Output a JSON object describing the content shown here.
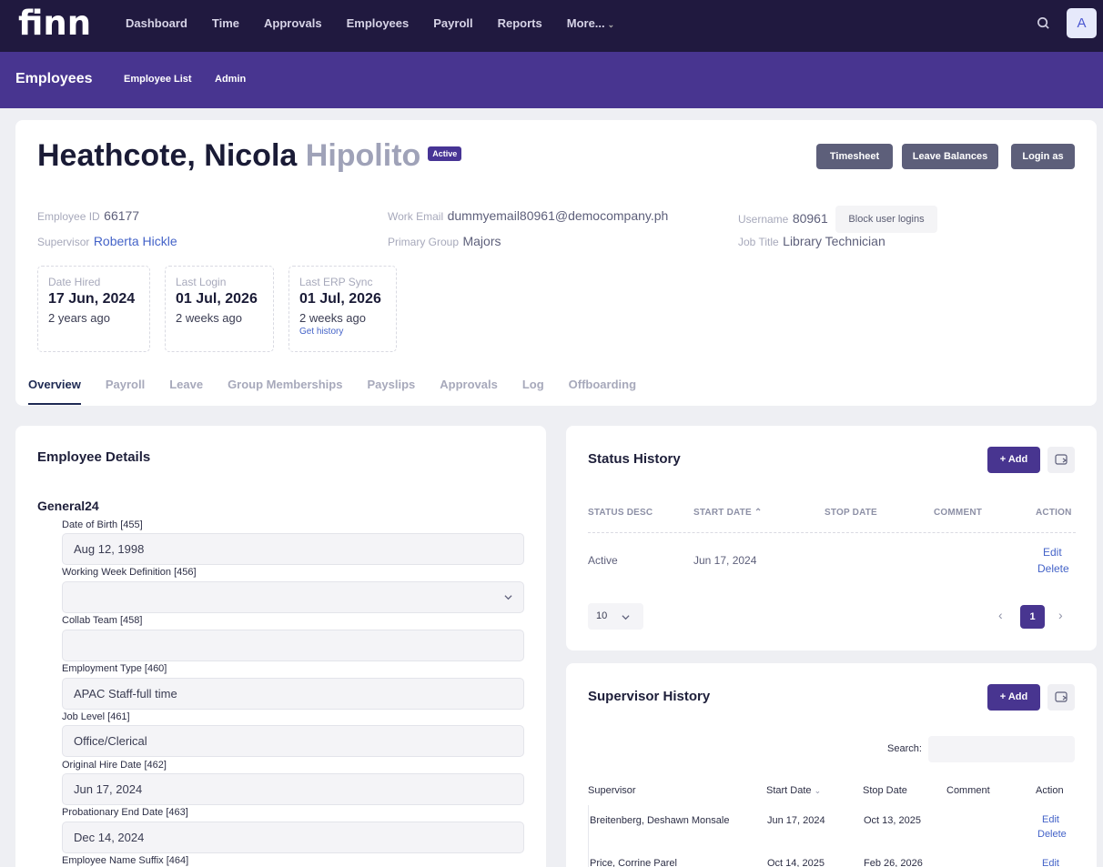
{
  "app": {
    "logo": "finn"
  },
  "nav": {
    "items": [
      "Dashboard",
      "Time",
      "Approvals",
      "Employees",
      "Payroll",
      "Reports",
      "More..."
    ],
    "avatar": "A"
  },
  "subnav": {
    "section": "Employees",
    "items": [
      "Employee List",
      "Admin"
    ]
  },
  "employee": {
    "last_first": "Heathcote, Nicola",
    "middle": "Hipolito",
    "status": "Active",
    "buttons": [
      "Timesheet",
      "Leave Balances",
      "Login as"
    ],
    "id_label": "Employee ID",
    "id": "66177",
    "supervisor_label": "Supervisor",
    "supervisor": "Roberta Hickle",
    "email_label": "Work Email",
    "email": "dummyemail80961@democompany.ph",
    "group_label": "Primary Group",
    "group": "Majors",
    "username_label": "Username",
    "username": "80961",
    "block_label": "Block user logins",
    "title_label": "Job Title",
    "title": "Library Technician"
  },
  "stats": [
    {
      "label": "Date Hired",
      "date": "17 Jun, 2024",
      "ago": "2 years ago"
    },
    {
      "label": "Last Login",
      "date": "01 Jul, 2026",
      "ago": "2 weeks ago"
    },
    {
      "label": "Last ERP Sync",
      "date": "01 Jul, 2026",
      "ago": "2 weeks ago",
      "link": "Get history"
    }
  ],
  "tabs": [
    "Overview",
    "Payroll",
    "Leave",
    "Group Memberships",
    "Payslips",
    "Approvals",
    "Log",
    "Offboarding"
  ],
  "details": {
    "title": "Employee Details",
    "group": "General24",
    "fields": [
      {
        "label": "Date of Birth [455]",
        "value": "Aug 12, 1998"
      },
      {
        "label": "Working Week Definition [456]",
        "value": ""
      },
      {
        "label": "Collab Team [458]",
        "value": ""
      },
      {
        "label": "Employment Type [460]",
        "value": "APAC Staff-full time"
      },
      {
        "label": "Job Level [461]",
        "value": "Office/Clerical"
      },
      {
        "label": "Original Hire Date [462]",
        "value": "Jun 17, 2024"
      },
      {
        "label": "Probationary End Date [463]",
        "value": "Dec 14, 2024"
      },
      {
        "label": "Employee Name Suffix [464]",
        "value": ""
      }
    ]
  },
  "status_history": {
    "title": "Status History",
    "add": "+ Add",
    "columns": [
      "STATUS DESC",
      "START DATE",
      "STOP DATE",
      "COMMENT",
      "ACTION"
    ],
    "rows": [
      {
        "status": "Active",
        "start": "Jun 17, 2024",
        "stop": "",
        "comment": "",
        "edit": "Edit",
        "delete": "Delete"
      }
    ],
    "page_size": "10",
    "page": "1"
  },
  "supervisor_history": {
    "title": "Supervisor History",
    "add": "+ Add",
    "search_label": "Search:",
    "columns": [
      "Supervisor",
      "Start Date",
      "Stop Date",
      "Comment",
      "Action"
    ],
    "rows": [
      {
        "supervisor": "Breitenberg, Deshawn Monsale",
        "start": "Jun 17, 2024",
        "stop": "Oct 13, 2025",
        "edit": "Edit",
        "delete": "Delete"
      },
      {
        "supervisor": "Price, Corrine Parel",
        "start": "Oct 14, 2025",
        "stop": "Feb 26, 2026",
        "edit": "Edit",
        "delete": ""
      }
    ]
  }
}
